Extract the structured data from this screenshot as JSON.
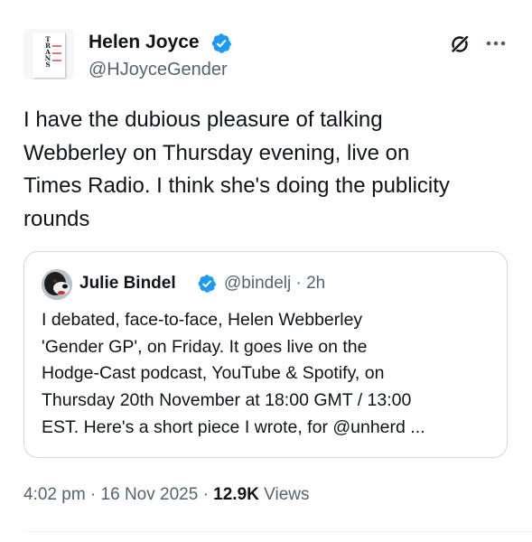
{
  "author": {
    "name": "Helen Joyce",
    "handle": "@HJoyceGender",
    "avatar_book_letters": "TRANS"
  },
  "tweet": {
    "lines": [
      "I have the dubious pleasure of talking",
      "Webberley on Thursday evening, live on",
      "Times Radio. I think she's doing the publicity",
      "rounds"
    ]
  },
  "quoted": {
    "name": "Julie Bindel",
    "handle_time": "@bindelj · 2h",
    "lines": [
      "I debated, face-to-face, Helen Webberley",
      "'Gender GP', on Friday. It goes live on the",
      "Hodge-Cast podcast, YouTube & Spotify, on",
      "Thursday 20th November at 18:00 GMT / 13:00",
      "EST. Here's a short piece I wrote, for @unherd ..."
    ]
  },
  "meta": {
    "timestamp": "4:02 pm · 16 Nov 2025 · ",
    "views_count": "12.9K",
    "views_label": " Views"
  },
  "icons": {
    "verified": "verified-badge-icon",
    "grok": "grok-icon",
    "more": "more-options-icon"
  },
  "colors": {
    "verified_blue": "#1d9bf0",
    "text_primary": "#0f1419",
    "text_secondary": "#536471",
    "border": "#cfd9de"
  }
}
